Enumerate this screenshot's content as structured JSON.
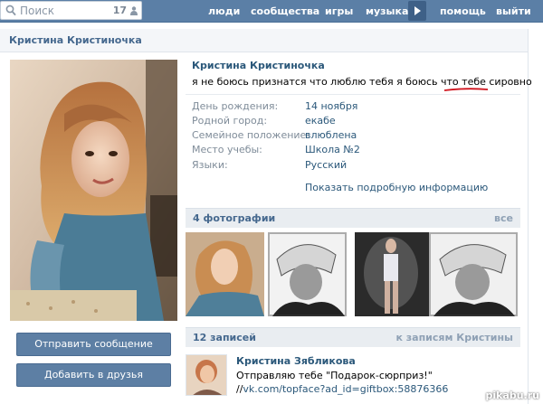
{
  "header": {
    "search_placeholder": "Поиск",
    "search_count": "17",
    "nav": {
      "people": "люди",
      "communities": "сообщества",
      "games": "игры",
      "music": "музыка",
      "help": "помощь",
      "logout": "выйти"
    }
  },
  "page_title": "Кристина Кристиночка",
  "actions": {
    "send_message": "Отправить сообщение",
    "add_friend": "Добавить в друзья"
  },
  "profile": {
    "name": "Кристина Кристиночка",
    "status": "я не боюсь признатся что люблю тебя я боюсь что тебе сировно",
    "fields": [
      {
        "label": "День рождения:",
        "value": "14 ноября"
      },
      {
        "label": "Родной город:",
        "value": "екабе"
      },
      {
        "label": "Семейное положение:",
        "value": "влюблена"
      },
      {
        "label": "Место учебы:",
        "value": "Школа №2"
      },
      {
        "label": "Языки:",
        "value": "Русский"
      }
    ],
    "show_more": "Показать подробную информацию"
  },
  "photos": {
    "header": "4 фотографии",
    "all_link": "все"
  },
  "wall": {
    "header": "12 записей",
    "link": "к записям Кристины",
    "post": {
      "author": "Кристина Зябликова",
      "text_prefix": "Отправляю тебе \"Подарок-сюрприз!\" //",
      "link": "vk.com/topface?ad_id=giftbox:58876366"
    }
  },
  "watermark": "pikabu.ru",
  "colors": {
    "topbar": "#5b7fa6",
    "button": "#5d7fa4",
    "link": "#2b587a",
    "underline": "#d0141e"
  }
}
